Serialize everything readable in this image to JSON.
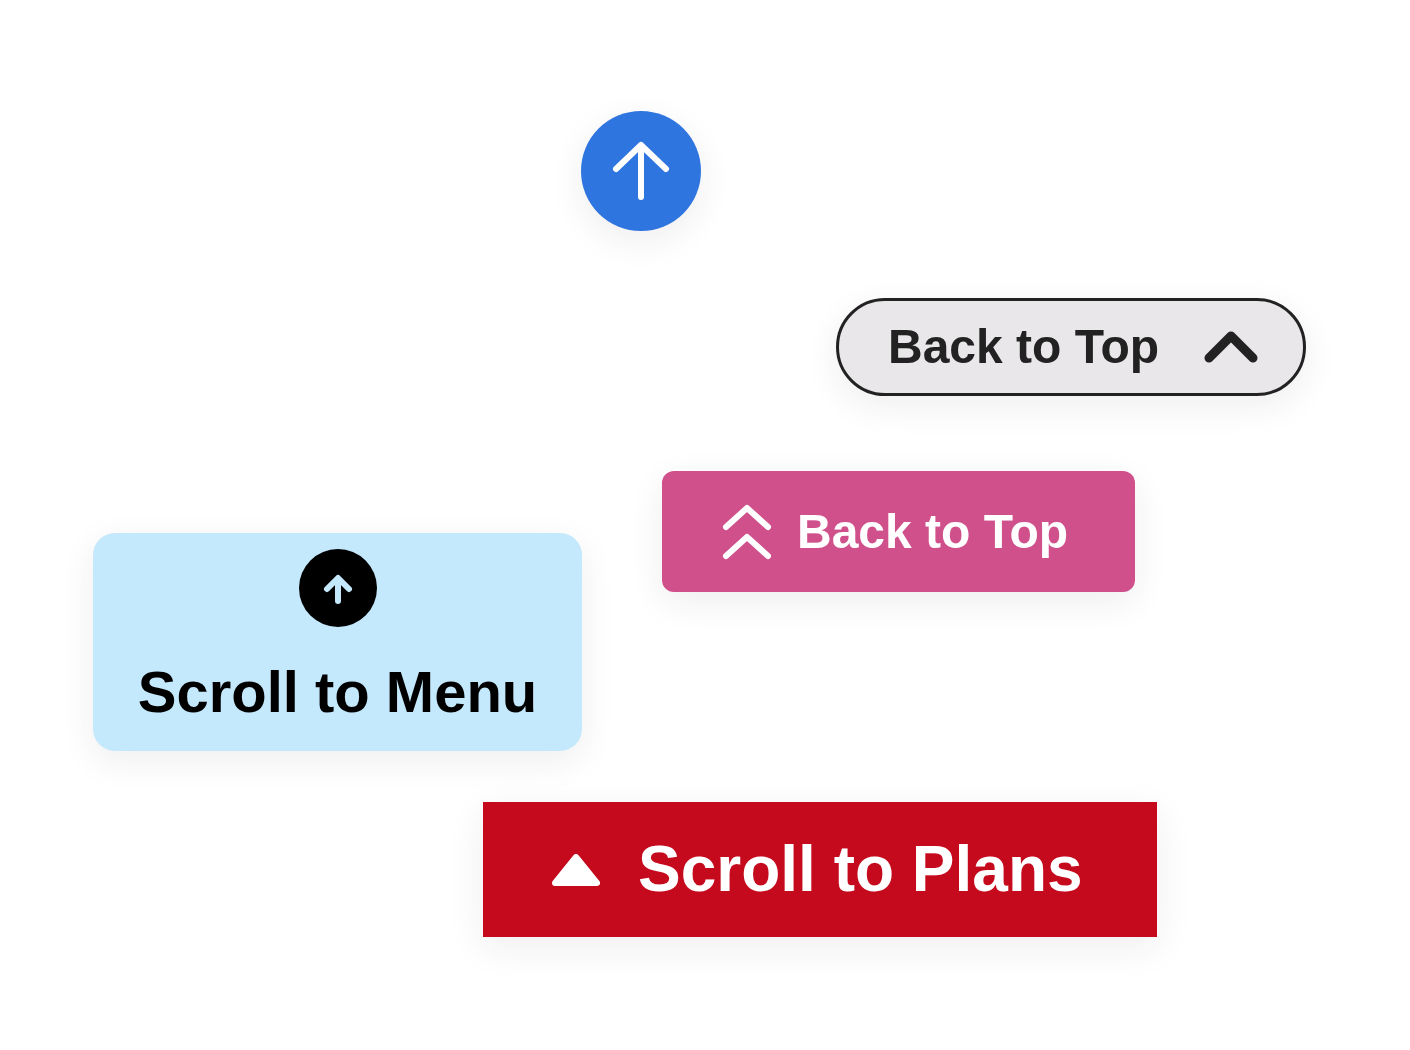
{
  "buttons": [
    {
      "kind": "round"
    },
    {
      "kind": "pill",
      "label": "Back to Top"
    },
    {
      "kind": "block",
      "label": "Back to Top"
    },
    {
      "kind": "tile",
      "label": "Scroll to Menu"
    },
    {
      "kind": "bar",
      "label": "Scroll to Plans"
    }
  ]
}
